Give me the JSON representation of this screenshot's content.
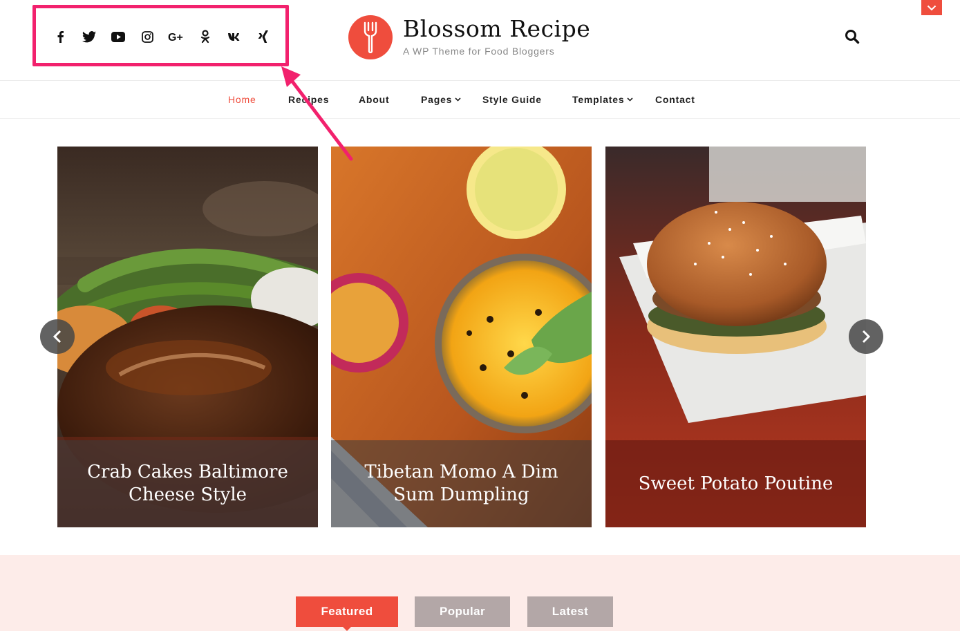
{
  "site": {
    "title": "Blossom Recipe",
    "tagline": "A WP Theme for Food Bloggers"
  },
  "social_icons": [
    "facebook-icon",
    "twitter-icon",
    "youtube-icon",
    "instagram-icon",
    "google-plus-icon",
    "odnoklassniki-icon",
    "vk-icon",
    "xing-icon"
  ],
  "nav": {
    "home": "Home",
    "recipes": "Recipes",
    "about": "About",
    "pages": "Pages",
    "style_guide": "Style Guide",
    "templates": "Templates",
    "contact": "Contact"
  },
  "slides": [
    {
      "title": "Crab Cakes Baltimore Cheese Style"
    },
    {
      "title": "Tibetan Momo A Dim Sum Dumpling"
    },
    {
      "title": "Sweet Potato Poutine"
    }
  ],
  "tabs": {
    "featured": "Featured",
    "popular": "Popular",
    "latest": "Latest"
  },
  "colors": {
    "accent": "#ef4d3d",
    "annotation": "#f2216d",
    "band_background": "#fdece9",
    "inactive_tab": "#b3a7a7"
  }
}
